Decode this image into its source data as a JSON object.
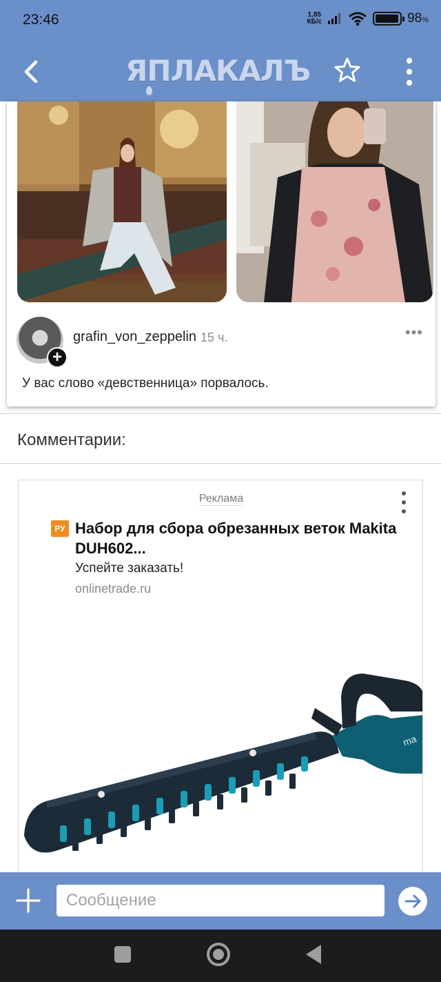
{
  "status_bar": {
    "time": "23:46",
    "net_speed_value": "1,85",
    "net_speed_unit": "КБ/с",
    "battery_percent": "98",
    "battery_unit": "%"
  },
  "header": {
    "logo_text": "ЯПЛАКАЛЪ",
    "icons": [
      "back-arrow-icon",
      "star-icon",
      "more-vertical-icon"
    ]
  },
  "post": {
    "username": "grafin_von_zeppelin",
    "time_ago": "15 ч.",
    "more_label": "•••",
    "caption": "У вас слово «девственница» порвалось.",
    "avatar_badge": "+"
  },
  "comments": {
    "title": "Комментарии:"
  },
  "ad": {
    "label": "Реклама",
    "badge": "РУ",
    "title": "Набор для сбора обрезанных веток Makita DUH602...",
    "subtitle": "Успейте заказать!",
    "domain": "onlinetrade.ru"
  },
  "composer": {
    "placeholder": "Сообщение"
  },
  "colors": {
    "header_bg": "#6a8fc9",
    "nav_bg": "#1b1c1e",
    "ad_badge": "#f08c1e"
  }
}
